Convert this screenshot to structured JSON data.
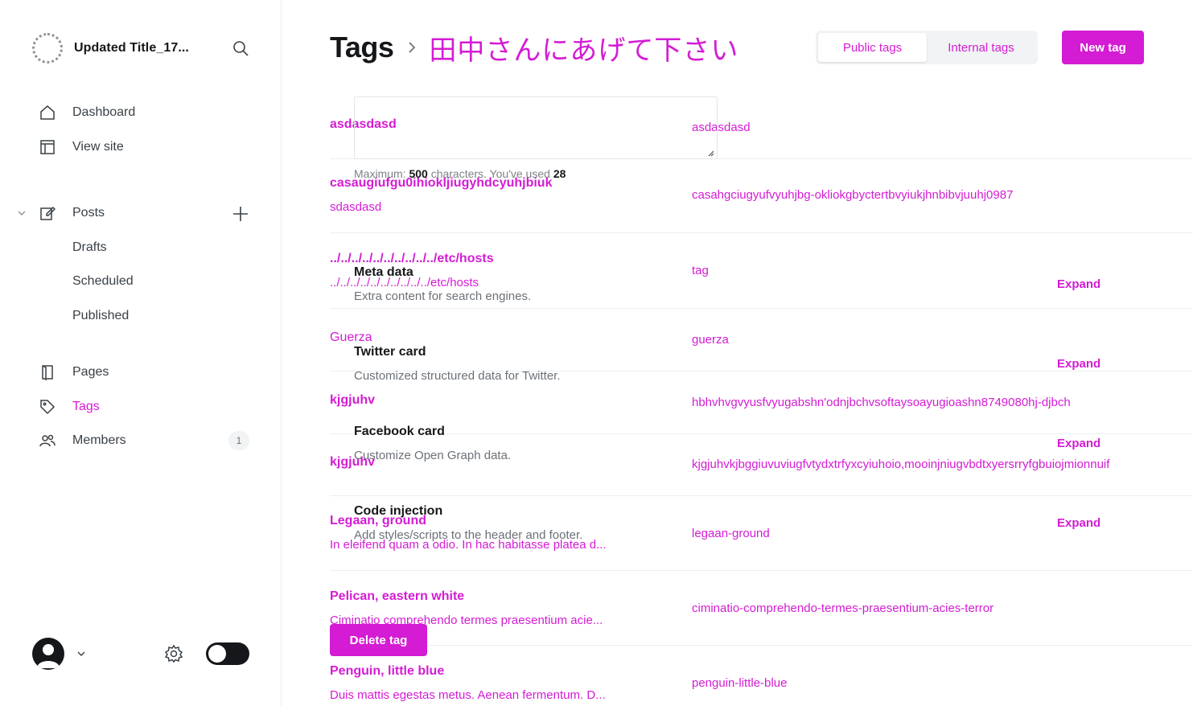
{
  "sidebar": {
    "site_title": "Updated Title_17...",
    "nav": {
      "dashboard": "Dashboard",
      "view_site": "View site",
      "posts": "Posts",
      "drafts": "Drafts",
      "scheduled": "Scheduled",
      "published": "Published",
      "pages": "Pages",
      "tags": "Tags",
      "members": "Members",
      "members_count": "1"
    }
  },
  "header": {
    "title": "Tags",
    "breadcrumb_current": "田中さんにあげて下さい",
    "tabs": [
      "Public tags",
      "Internal tags"
    ],
    "active_tab": "Public tags",
    "new_tag": "New tag"
  },
  "tags": [
    {
      "name": "asdasdasd",
      "description": "",
      "slug": "asdasdasd"
    },
    {
      "name": "casaugiufgu0ihiokljiugyhdcyuhjbiuk",
      "description": "sdasdasd",
      "slug": "casahgciugyufvyuhjbg-okliokgbyctertbvyiukjhnbibvjuuhj0987"
    },
    {
      "name": "../../../../../../../../../../etc/hosts",
      "description": "../../../../../../../../../../etc/hosts",
      "slug": "tag"
    },
    {
      "name": "Guerza",
      "description": "",
      "slug": "guerza"
    },
    {
      "name": "kjgjuhv",
      "description": "",
      "slug": "hbhvhvgvyusfvyugabshn'odnjbchvsoftaysoayugioashn8749080hj-djbch"
    },
    {
      "name": "kjgjuhv",
      "description": "",
      "slug": "kjgjuhvkjbggiuvuviugfvtydxtrfyxcyiuhoio,mooinjniugvbdtxyersrryfgbuiojmionnuif"
    },
    {
      "name": "Legaan, ground",
      "description": "In eleifend quam a odio. In hac habitasse platea d...",
      "slug": "legaan-ground"
    },
    {
      "name": "Pelican, eastern white",
      "description": "Ciminatio comprehendo termes praesentium acie...",
      "slug": "ciminatio-comprehendo-termes-praesentium-acies-terror"
    },
    {
      "name": "Penguin, little blue",
      "description": "Duis mattis egestas metus. Aenean fermentum. D...",
      "slug": "penguin-little-blue"
    }
  ],
  "overlay": {
    "char_hint_prefix": "Maximum: ",
    "char_hint_max": "500",
    "char_hint_mid": " characters. You've used ",
    "char_hint_used": "28",
    "sections": [
      {
        "title": "Meta data",
        "description": "Extra content for search engines.",
        "action": "Expand"
      },
      {
        "title": "Twitter card",
        "description": "Customized structured data for Twitter.",
        "action": "Expand"
      },
      {
        "title": "Facebook card",
        "description": "Customize Open Graph data.",
        "action": "Expand"
      },
      {
        "title": "Code injection",
        "description": "Add styles/scripts to the header and footer.",
        "action": "Expand"
      }
    ],
    "delete_button": "Delete tag"
  },
  "colors": {
    "accent": "#d41cd4",
    "text": "#15171a",
    "muted": "#6b7177",
    "border": "#ebeef0"
  },
  "icons": [
    "site-logo",
    "search-icon",
    "home-icon",
    "view-site-icon",
    "chevron-down-icon",
    "posts-icon",
    "plus-icon",
    "pages-icon",
    "tag-icon",
    "members-icon",
    "chevron-right-icon",
    "gear-icon"
  ]
}
